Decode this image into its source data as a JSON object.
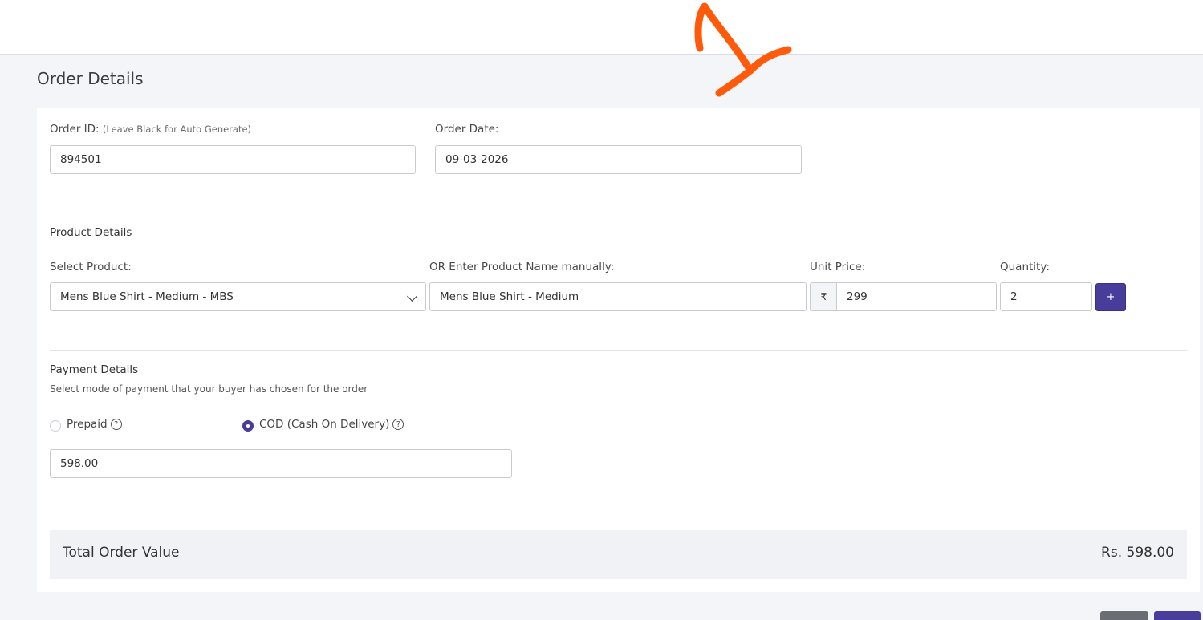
{
  "page": {
    "title": "Order Details"
  },
  "order": {
    "id_label": "Order ID:",
    "id_hint": "(Leave Black for Auto Generate)",
    "id_value": "894501",
    "date_label": "Order Date:",
    "date_value": "09-03-2026"
  },
  "product": {
    "section_title": "Product Details",
    "select_label": "Select Product:",
    "select_value": "Mens Blue Shirt - Medium - MBS",
    "manual_label": "OR Enter Product Name manually:",
    "manual_value": "Mens Blue Shirt - Medium",
    "unit_price_label": "Unit Price:",
    "currency_symbol": "₹",
    "unit_price_value": "299",
    "quantity_label": "Quantity:",
    "quantity_value": "2",
    "add_button_label": "+"
  },
  "payment": {
    "section_title": "Payment Details",
    "subtitle": "Select mode of payment that your buyer has chosen for the order",
    "option_prepaid": "Prepaid",
    "option_cod": "COD (Cash On Delivery)",
    "selected": "COD (Cash On Delivery)",
    "help_glyph": "?",
    "amount_value": "598.00"
  },
  "total": {
    "label": "Total Order Value",
    "value": "Rs. 598.00"
  },
  "colors": {
    "accent": "#483d9b",
    "annotation": "#ff5a0a"
  },
  "icons": [
    "chevron-down-icon",
    "rupee-icon",
    "help-circle-icon",
    "radio-icon"
  ]
}
